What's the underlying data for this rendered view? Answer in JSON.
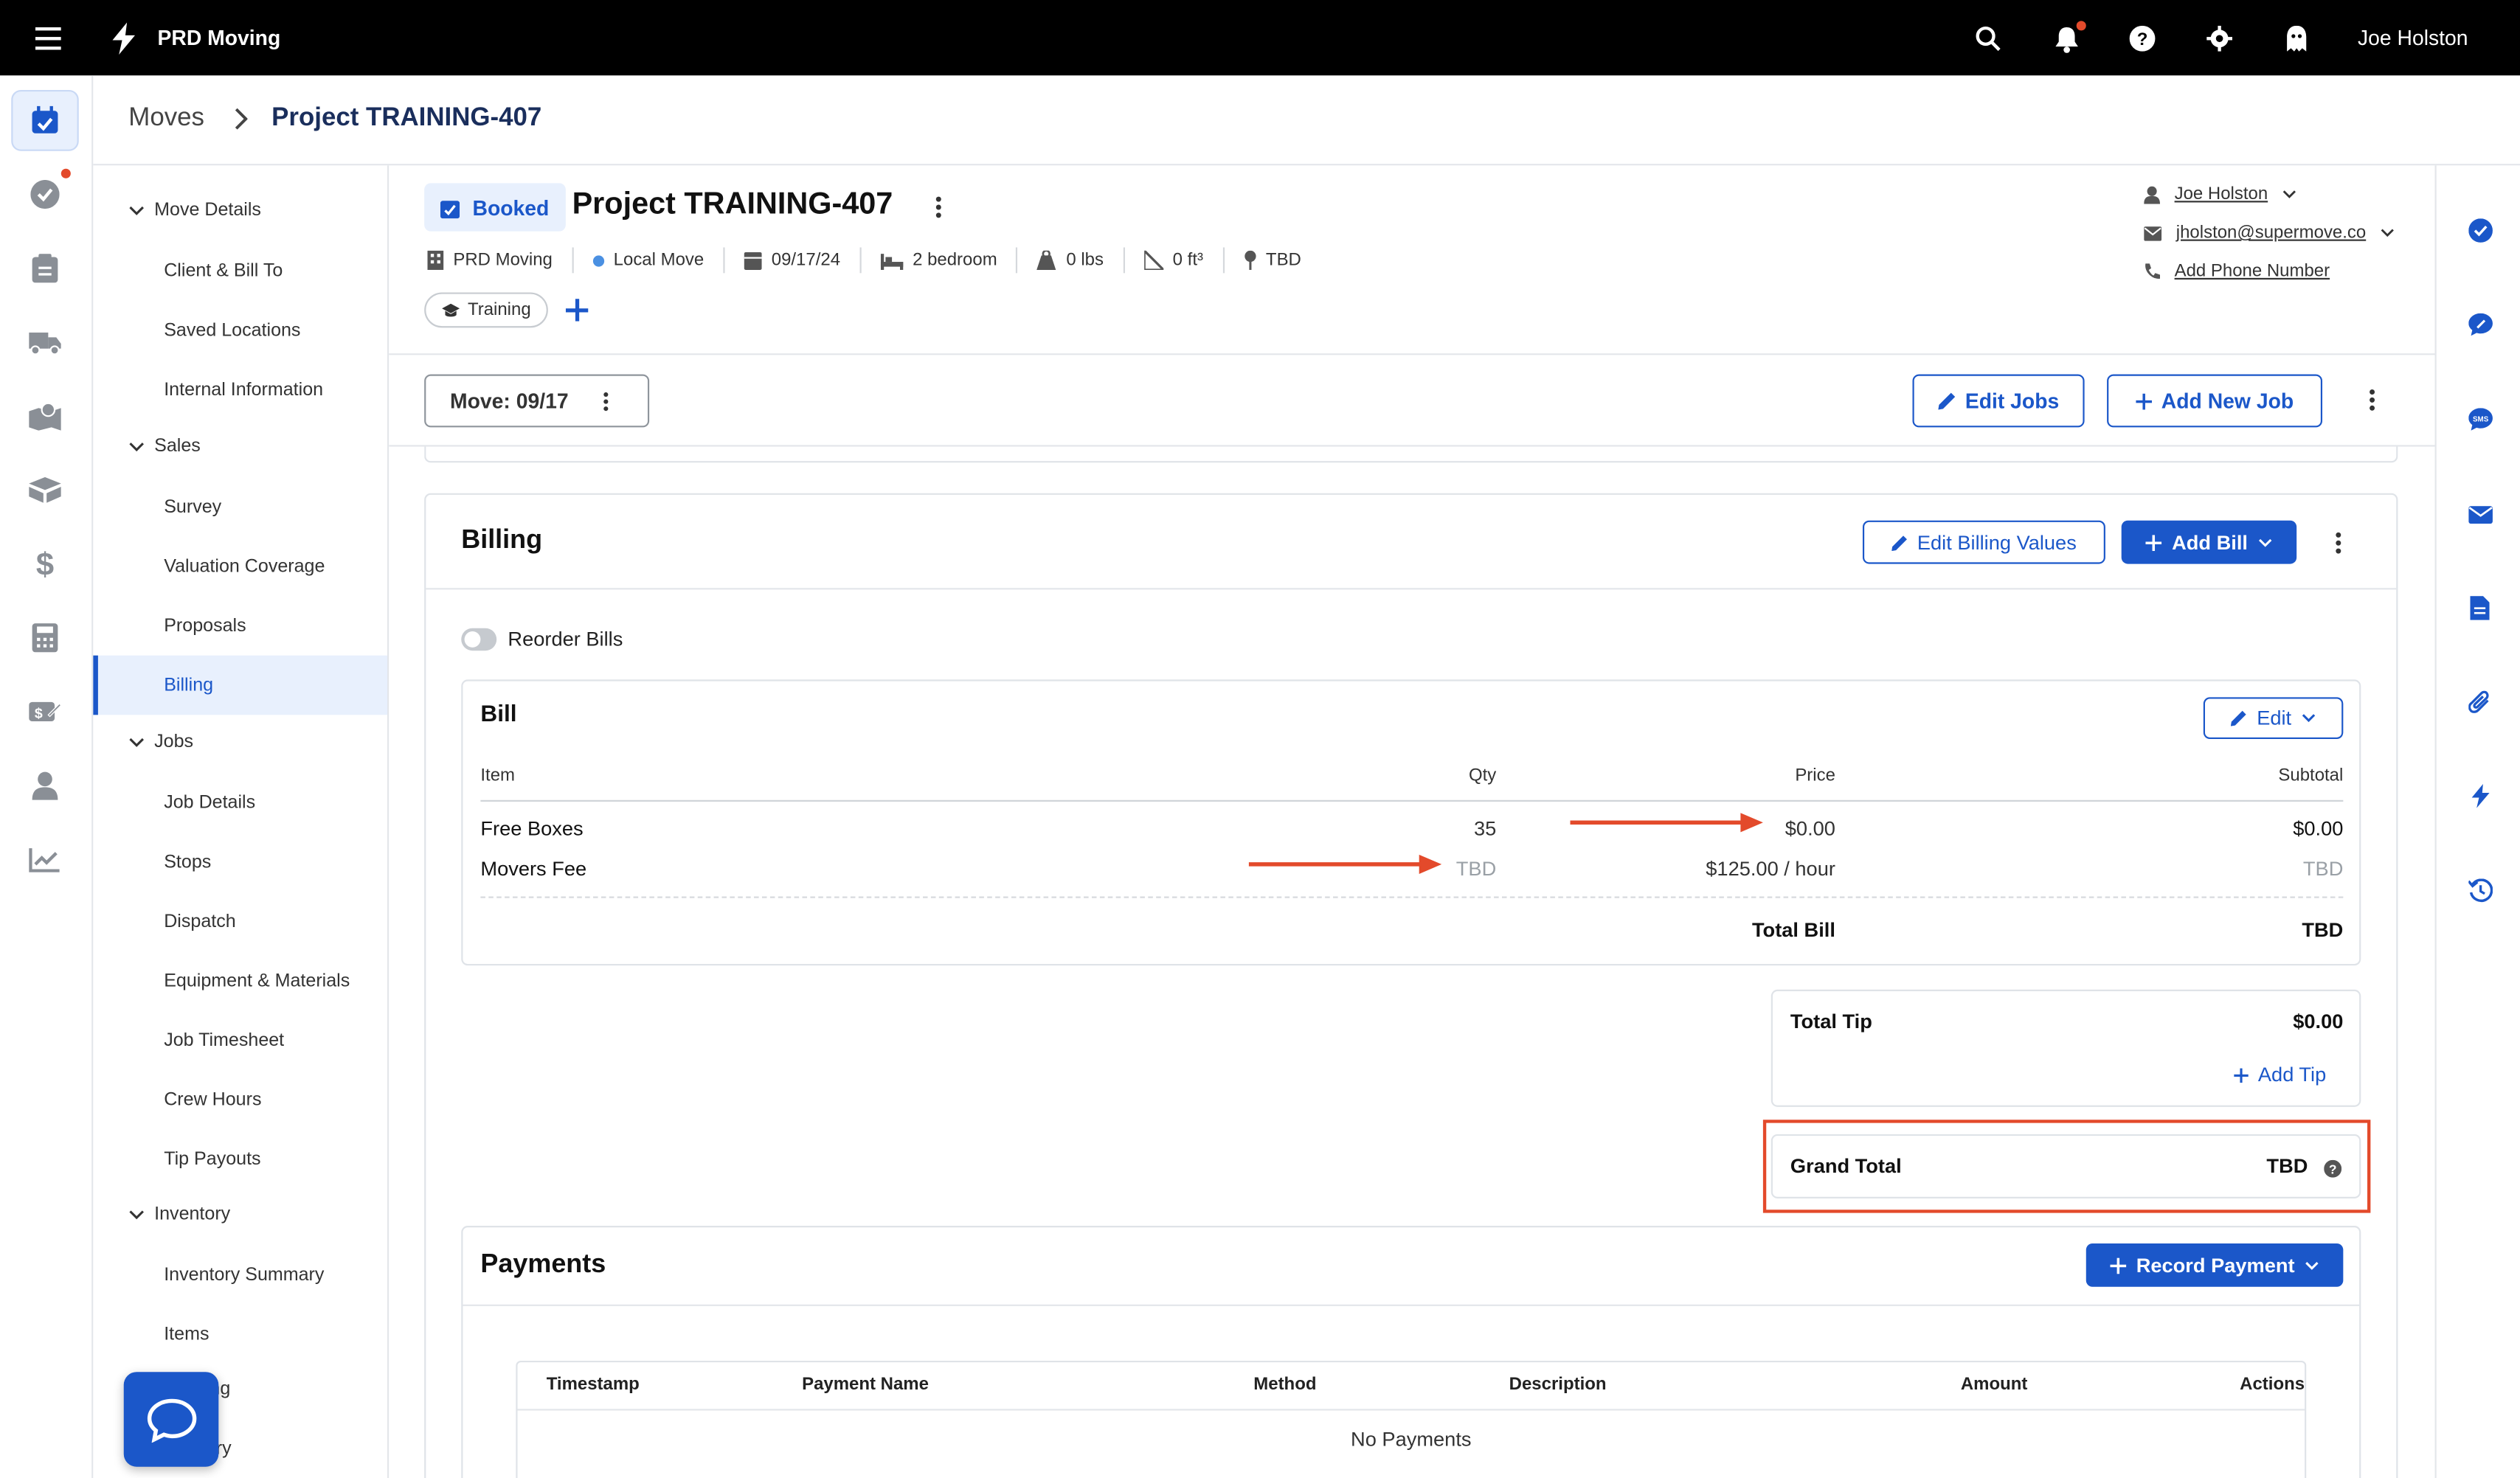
{
  "app": {
    "name": "PRD Moving",
    "user": "Joe Holston"
  },
  "breadcrumb": {
    "root": "Moves",
    "current": "Project TRAINING-407"
  },
  "project": {
    "status": "Booked",
    "title": "Project TRAINING-407",
    "meta": {
      "company": "PRD Moving",
      "move_type": "Local Move",
      "date": "09/17/24",
      "size": "2 bedroom",
      "weight": "0 lbs",
      "volume": "0 ft³",
      "location": "TBD"
    },
    "tag": "Training",
    "contact": {
      "name": "Joe Holston",
      "email": "jholston@supermove.co",
      "phone": "Add Phone Number"
    }
  },
  "job_bar": {
    "move_label": "Move: 09/17",
    "edit_jobs": "Edit Jobs",
    "add_job": "Add New Job"
  },
  "nav": {
    "move_details": "Move Details",
    "client_bill_to": "Client & Bill To",
    "saved_locations": "Saved Locations",
    "internal_information": "Internal Information",
    "sales": "Sales",
    "survey": "Survey",
    "valuation_coverage": "Valuation Coverage",
    "proposals": "Proposals",
    "billing": "Billing",
    "jobs": "Jobs",
    "job_details": "Job Details",
    "stops": "Stops",
    "dispatch": "Dispatch",
    "equipment_materials": "Equipment & Materials",
    "job_timesheet": "Job Timesheet",
    "crew_hours": "Crew Hours",
    "tip_payouts": "Tip Payouts",
    "inventory": "Inventory",
    "inventory_summary": "Inventory Summary",
    "items": "Items",
    "partial_1": "ing",
    "partial_2": "ary"
  },
  "billing": {
    "title": "Billing",
    "edit_values": "Edit Billing Values",
    "add_bill": "Add Bill",
    "reorder": "Reorder Bills",
    "bill": {
      "title": "Bill",
      "edit": "Edit",
      "headers": {
        "item": "Item",
        "qty": "Qty",
        "price": "Price",
        "subtotal": "Subtotal"
      },
      "rows": [
        {
          "item": "Free Boxes",
          "qty": "35",
          "price": "$0.00",
          "subtotal": "$0.00"
        },
        {
          "item": "Movers Fee",
          "qty": "TBD",
          "price": "$125.00 / hour",
          "subtotal": "TBD"
        }
      ],
      "total_label": "Total Bill",
      "total_value": "TBD"
    },
    "tip": {
      "label": "Total Tip",
      "value": "$0.00",
      "add": "Add Tip"
    },
    "grand_total": {
      "label": "Grand Total",
      "value": "TBD"
    }
  },
  "payments": {
    "title": "Payments",
    "record": "Record Payment",
    "headers": {
      "timestamp": "Timestamp",
      "name": "Payment Name",
      "method": "Method",
      "description": "Description",
      "amount": "Amount",
      "actions": "Actions"
    },
    "empty": "No Payments"
  },
  "colors": {
    "brand": "#1b57c9",
    "annotation": "#e34a2b",
    "topbar": "#000000"
  }
}
